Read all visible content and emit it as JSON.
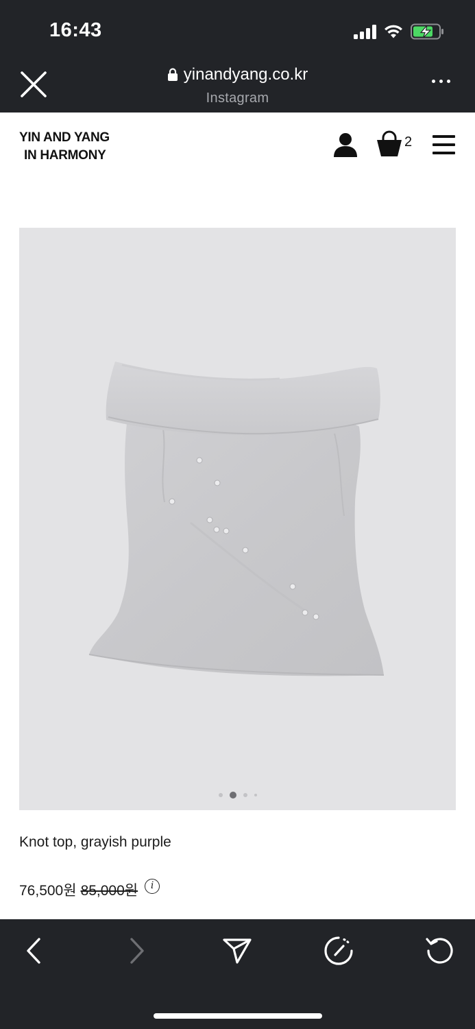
{
  "status_bar": {
    "time": "16:43",
    "battery_state": "charging",
    "signal_bars": 4
  },
  "browser": {
    "url": "yinandyang.co.kr",
    "source_app": "Instagram",
    "close_icon": "close-icon",
    "more_icon": "more-icon"
  },
  "site": {
    "logo_line1": "YIN AND YANG",
    "logo_line2": "IN HARMONY",
    "cart_count": "2"
  },
  "product": {
    "name": "Knot top, grayish purple",
    "sale_price": "76,500원",
    "original_price": "85,000원",
    "image_count": 4,
    "active_image_index": 1
  },
  "toolbar": {
    "items": [
      "back-icon",
      "forward-icon",
      "share-icon",
      "speed-icon",
      "reload-icon"
    ]
  },
  "colors": {
    "chrome_bg": "#222428",
    "image_bg": "#e3e3e5",
    "text": "#1c1c1c",
    "battery_fill": "#4cd964"
  }
}
